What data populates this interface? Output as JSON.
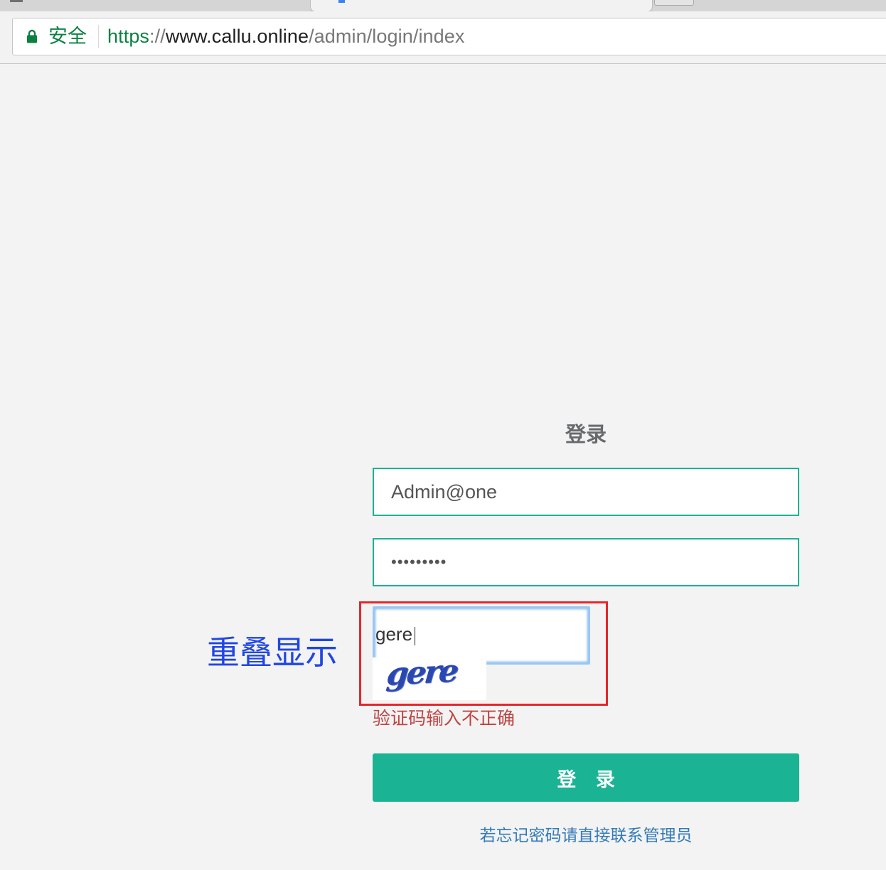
{
  "browser": {
    "security_label": "安全",
    "url": {
      "scheme": "https",
      "separator": "://",
      "host": "www.callu.online",
      "path": "/admin/login/index"
    }
  },
  "login": {
    "title": "登录",
    "username_value": "Admin@one",
    "password_value": "password1",
    "captcha_value": "gere",
    "captcha_image_text": "gere",
    "captcha_error": "验证码输入不正确",
    "submit_label": "登 录",
    "forgot_password_text": "若忘记密码请直接联系管理员"
  },
  "annotation": {
    "note": "重叠显示",
    "note_color": "#2046e6",
    "highlight_color": "#e8262b"
  },
  "theme": {
    "accent": "#1ab394",
    "secure_green": "#0b8043",
    "error_red": "#bf4442",
    "link_blue": "#337ab7"
  }
}
